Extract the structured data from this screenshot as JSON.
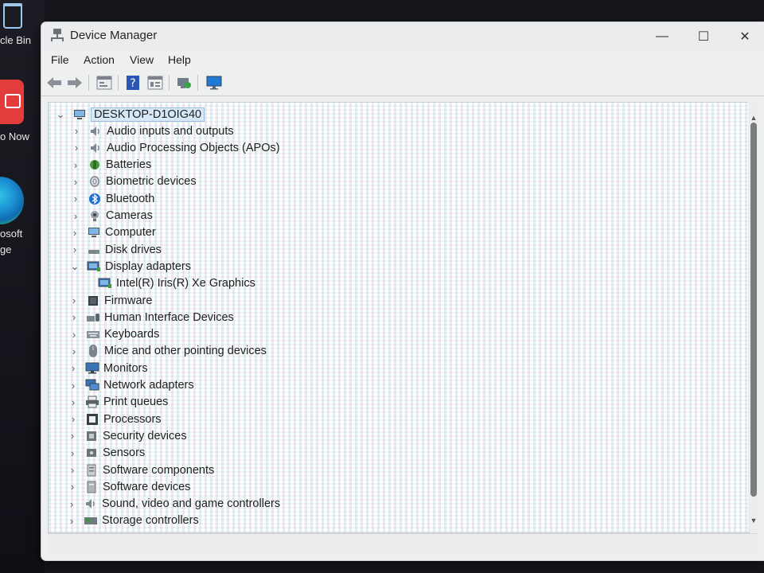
{
  "desktop": {
    "recycle_label": "cle Bin",
    "app_label": "o Now",
    "edge_label_1": "osoft",
    "edge_label_2": "ge"
  },
  "window": {
    "title": "Device Manager",
    "minimize_glyph": "—",
    "maximize_glyph": "☐",
    "close_glyph": "✕"
  },
  "menu": [
    "File",
    "Action",
    "View",
    "Help"
  ],
  "toolbar": {
    "back_icon": "back-arrow-icon",
    "forward_icon": "forward-arrow-icon",
    "properties_icon": "properties-icon",
    "help_icon": "help-icon",
    "view_icon": "view-icon",
    "scan_icon": "scan-hardware-icon",
    "monitor_icon": "monitor-icon"
  },
  "tree": {
    "root": "DESKTOP-D1OIG40",
    "items": [
      {
        "label": "Audio inputs and outputs",
        "icon": "speaker-icon"
      },
      {
        "label": "Audio Processing Objects (APOs)",
        "icon": "speaker-icon"
      },
      {
        "label": "Batteries",
        "icon": "battery-icon"
      },
      {
        "label": "Biometric devices",
        "icon": "fingerprint-icon"
      },
      {
        "label": "Bluetooth",
        "icon": "bluetooth-icon"
      },
      {
        "label": "Cameras",
        "icon": "camera-icon"
      },
      {
        "label": "Computer",
        "icon": "computer-icon"
      },
      {
        "label": "Disk drives",
        "icon": "disk-icon"
      },
      {
        "label": "Display adapters",
        "icon": "display-adapter-icon",
        "expanded": true
      },
      {
        "label": "Intel(R) Iris(R) Xe Graphics",
        "icon": "display-adapter-icon",
        "child": true
      },
      {
        "label": "Firmware",
        "icon": "firmware-icon"
      },
      {
        "label": "Human Interface Devices",
        "icon": "hid-icon"
      },
      {
        "label": "Keyboards",
        "icon": "keyboard-icon"
      },
      {
        "label": "Mice and other pointing devices",
        "icon": "mouse-icon"
      },
      {
        "label": "Monitors",
        "icon": "monitor-icon"
      },
      {
        "label": "Network adapters",
        "icon": "network-icon"
      },
      {
        "label": "Print queues",
        "icon": "printer-icon"
      },
      {
        "label": "Processors",
        "icon": "processor-icon"
      },
      {
        "label": "Security devices",
        "icon": "security-icon"
      },
      {
        "label": "Sensors",
        "icon": "sensor-icon"
      },
      {
        "label": "Software components",
        "icon": "software-component-icon"
      },
      {
        "label": "Software devices",
        "icon": "software-device-icon"
      },
      {
        "label": "Sound, video and game controllers",
        "icon": "speaker-icon"
      },
      {
        "label": "Storage controllers",
        "icon": "storage-icon"
      }
    ]
  },
  "colors": {
    "selection_bg": "#d7e8f8",
    "accent_blue": "#1f7ad6"
  }
}
